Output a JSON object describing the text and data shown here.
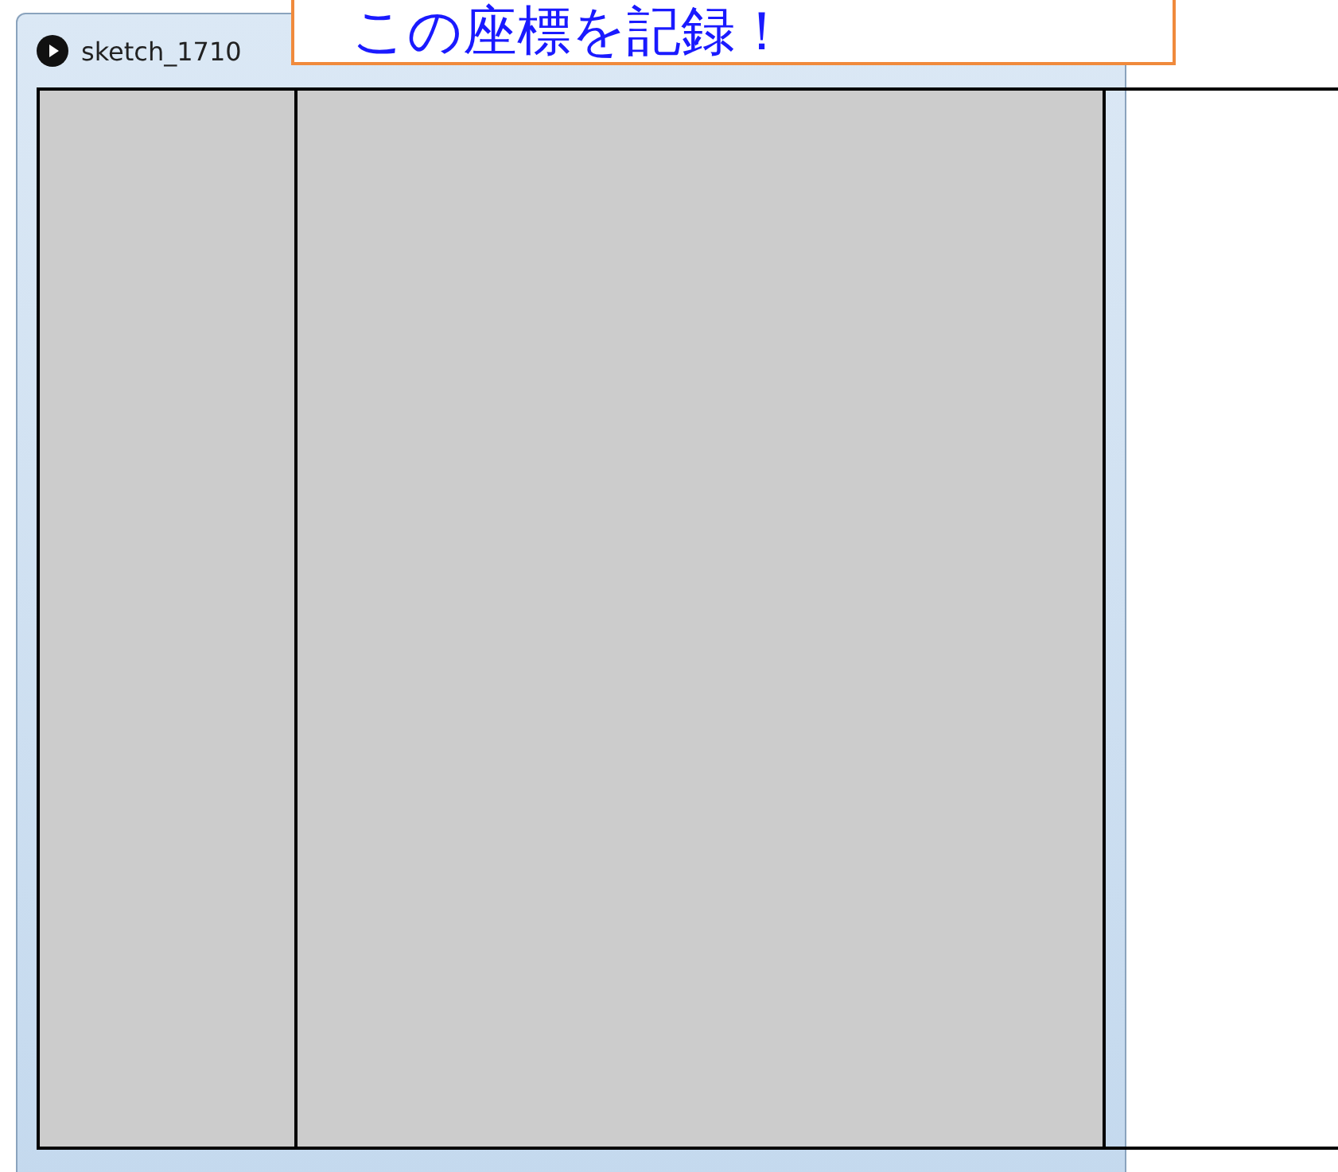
{
  "window": {
    "title": "sketch_1710"
  },
  "callout": {
    "text": "この座標を記録！"
  }
}
